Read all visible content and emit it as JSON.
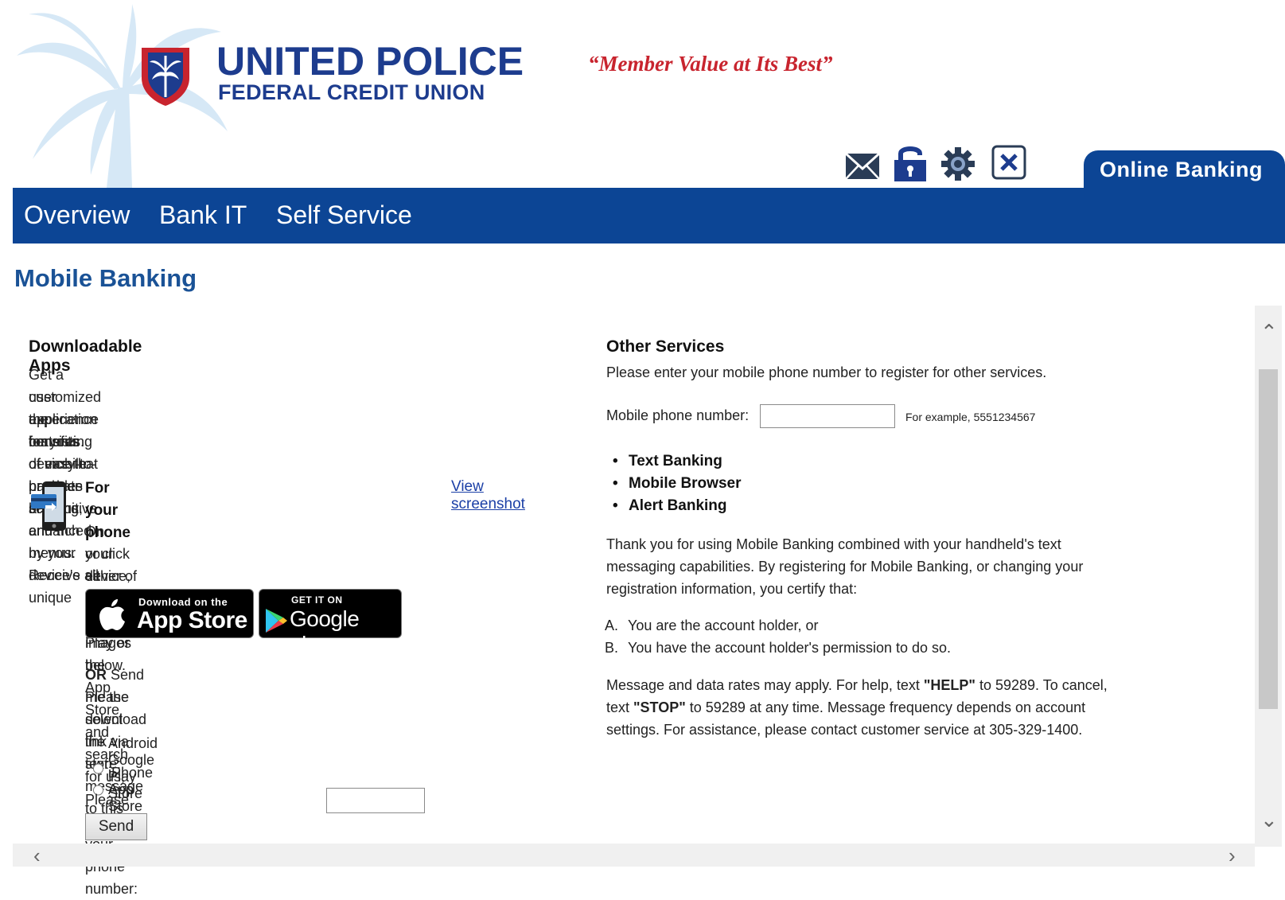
{
  "header": {
    "brand_name": "UNITED POLICE",
    "brand_sub": "FEDERAL CREDIT UNION",
    "tagline": "“Member Value at Its Best”",
    "online_banking_tab": "Online Banking",
    "icons": [
      "mail-icon",
      "lock-icon",
      "gear-icon",
      "close-icon"
    ],
    "brand_color": "#1d3c8e",
    "tagline_color": "#c8242e"
  },
  "nav": {
    "items": [
      "Overview",
      "Bank IT",
      "Self Service"
    ],
    "background": "#0c4595"
  },
  "page_title": "Mobile Banking",
  "downloadable_apps": {
    "heading": "Downloadable Apps",
    "intro_lines": [
      "Get a customized application for your device that provides an intuitive and rich",
      "user experience consisting of easy-to-navigate screens and menus. Receive all",
      "the benefits of mobile browser banking, enhanced by your device's unique",
      "features."
    ],
    "phone_heading": "For your phone",
    "view_screenshot_link": "View screenshot",
    "phone_desc_lines": [
      "On your device, open Google Play or the App Store and search for us,",
      "or click either of the download images below."
    ],
    "app_store_badge": {
      "small": "Download on the",
      "big": "App Store"
    },
    "google_play_badge": {
      "small": "GET IT ON",
      "big": "Google play"
    },
    "or_bold": "OR",
    "or_text": " Send me the download link via text message to this number:",
    "select_store": "Please select the store:",
    "radio_options": [
      "Android Google Play Store",
      "iPhone App Store"
    ],
    "phone_prompt": "Please provide your phone number:",
    "phone_value": "",
    "send_button": "Send"
  },
  "other_services": {
    "heading": "Other Services",
    "intro": "Please enter your mobile phone number to register for other services.",
    "phone_label": "Mobile phone number:",
    "phone_value": "",
    "example": "For example, 5551234567",
    "services": [
      "Text Banking",
      "Mobile Browser",
      "Alert Banking"
    ],
    "thanks_lines": [
      "Thank you for using Mobile Banking combined with your handheld's text",
      "messaging capabilities. By registering for Mobile Banking, or changing your",
      "registration information, you certify that:"
    ],
    "certify_items": [
      {
        "mark": "A.",
        "text": "You are the account holder, or"
      },
      {
        "mark": "B.",
        "text": "You have the account holder's permission to do so."
      }
    ],
    "rates_line1_a": "Message and data rates may apply. For help, text ",
    "rates_line1_help": "\"HELP\"",
    "rates_line1_b": " to 59289. To cancel,",
    "rates_line2_a": "text ",
    "rates_line2_stop": "\"STOP\"",
    "rates_line2_b": " to 59289 at any time. Message frequency depends on account",
    "rates_line3": "settings. For assistance, please contact customer service at 305-329-1400."
  }
}
